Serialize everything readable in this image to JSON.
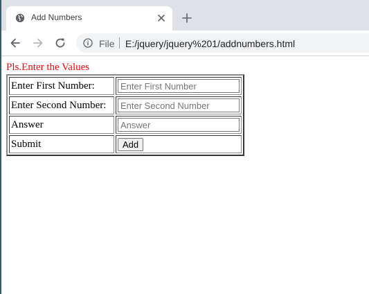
{
  "browser": {
    "tab": {
      "title": "Add Numbers",
      "favicon": "globe-icon",
      "close_icon": "close-icon"
    },
    "new_tab_icon": "plus-icon",
    "nav": {
      "back_icon": "back-arrow-icon",
      "forward_icon": "forward-arrow-icon",
      "reload_icon": "reload-icon"
    },
    "omnibox": {
      "info_icon": "info-icon",
      "scheme_label": "File",
      "url": "E:/jquery/jquery%201/addnumbers.html"
    }
  },
  "page": {
    "prompt": "Pls.Enter the Values",
    "prompt_color": "#ff0000",
    "rows": {
      "first": {
        "label": "Enter First Number:",
        "placeholder": "Enter First Number",
        "value": ""
      },
      "second": {
        "label": "Enter Second Number:",
        "placeholder": "Enter Second Number",
        "value": ""
      },
      "answer": {
        "label": "Answer",
        "placeholder": "Answer",
        "value": ""
      },
      "submit": {
        "label": "Submit",
        "button_label": "Add"
      }
    }
  }
}
